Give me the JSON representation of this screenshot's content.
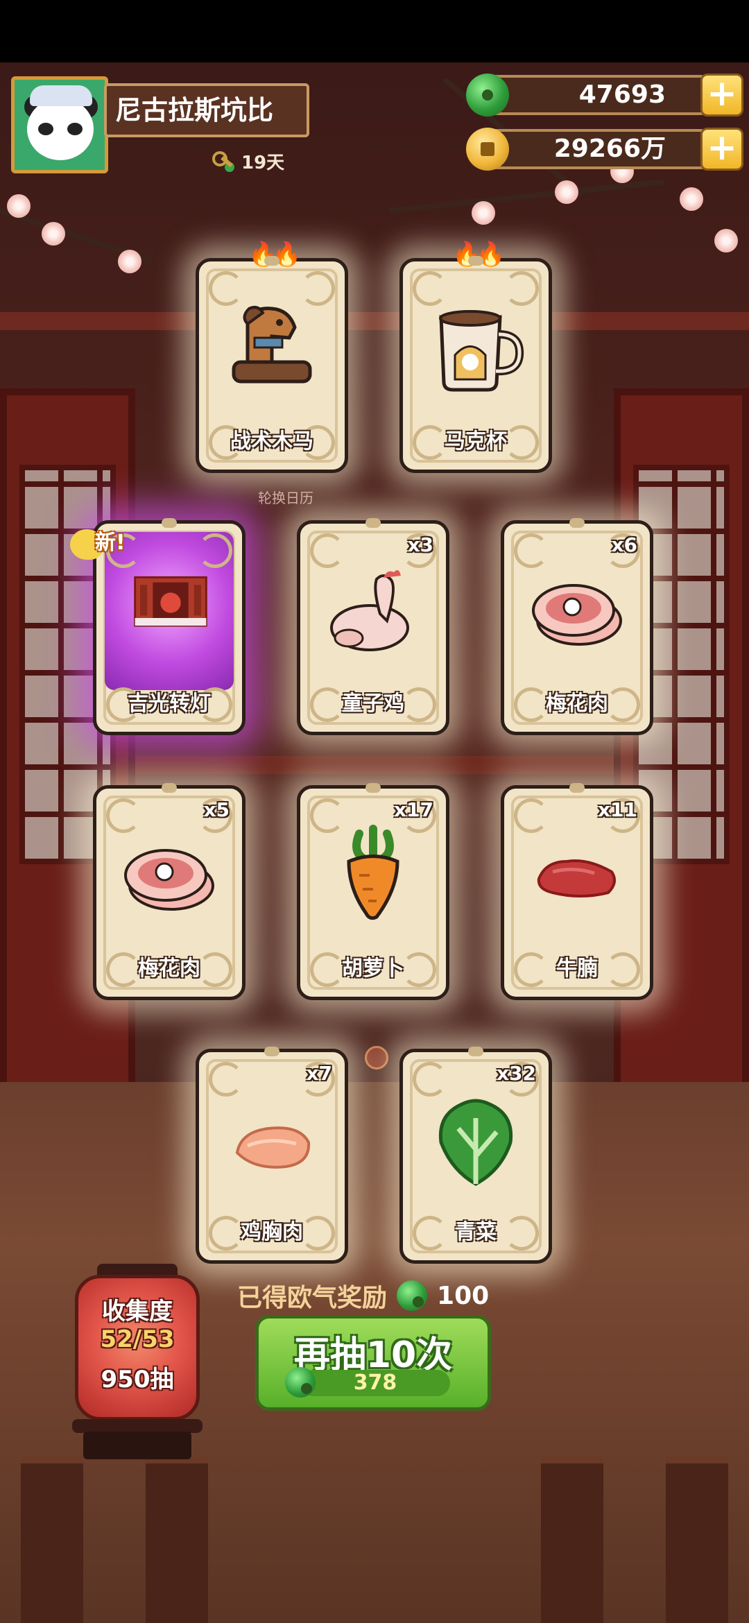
{
  "player": {
    "name": "尼古拉斯坑比",
    "days": "19天"
  },
  "currencies": {
    "jade": "47693",
    "gold": "29266万"
  },
  "calendar_label": "轮换日历",
  "cards": [
    {
      "label": "战术木马",
      "count": "",
      "art": "wooden-horse",
      "flames": "🔥🔥"
    },
    {
      "label": "马克杯",
      "count": "",
      "art": "mug",
      "flames": "🔥🔥"
    },
    {
      "label": "吉光转灯",
      "count": "",
      "art": "lantern-scene",
      "new_badge": "新!"
    },
    {
      "label": "童子鸡",
      "count": "x3",
      "art": "chicken"
    },
    {
      "label": "梅花肉",
      "count": "x6",
      "art": "pork"
    },
    {
      "label": "梅花肉",
      "count": "x5",
      "art": "pork"
    },
    {
      "label": "胡萝卜",
      "count": "x17",
      "art": "carrot"
    },
    {
      "label": "牛腩",
      "count": "x11",
      "art": "beef"
    },
    {
      "label": "鸡胸肉",
      "count": "x7",
      "art": "chicken-breast"
    },
    {
      "label": "青菜",
      "count": "x32",
      "art": "bok-choy"
    }
  ],
  "reward": {
    "label": "已得欧气奖励",
    "amount": "100"
  },
  "draw_button": {
    "label": "再抽10次",
    "cost": "378"
  },
  "collection": {
    "title": "收集度",
    "progress": "52/53",
    "draws": "950抽"
  },
  "colors": {
    "jade": "#2f9d3b",
    "gold": "#f0b73a",
    "draw_button": "#58b02a",
    "card_bg": "#f2e4c6",
    "purple_glow": "#c14be0"
  }
}
